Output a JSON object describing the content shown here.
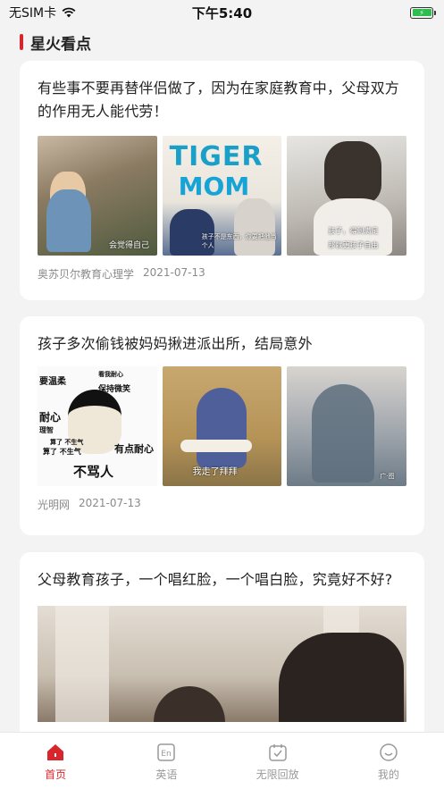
{
  "status_bar": {
    "carrier": "无SIM卡",
    "time": "下午5:40"
  },
  "section": {
    "title": "星火看点",
    "accent_color": "#d8262c"
  },
  "articles": [
    {
      "title": "有些事不要再替伴侣做了，因为在家庭教育中，父母双方的作用无人能代劳！",
      "images": [
        {
          "caption": "会觉得自己"
        },
        {
          "headline_1": "TIGER",
          "headline_2": "MOM",
          "caption": "孩子不是东西，你要把他当个人"
        },
        {
          "caption_1": "孩子，得到满足",
          "caption_2": "那就更孩子自由"
        }
      ],
      "source": "奥苏贝尔教育心理学",
      "date": "2021-07-13"
    },
    {
      "title": "孩子多次偷钱被妈妈揪进派出所，结局意外",
      "images": [
        {
          "words": [
            "看我耐心",
            "要温柔",
            "保持微笑",
            "耐心",
            "理智",
            "有点耐心",
            "算了 不生气",
            "算了 不生气"
          ],
          "big": "不骂人"
        },
        {
          "caption": "我走了拜拜"
        },
        {
          "caption": "广·图"
        }
      ],
      "source": "光明网",
      "date": "2021-07-13"
    },
    {
      "title": "父母教育孩子，一个唱红脸，一个唱白脸，究竟好不好?",
      "source": "",
      "date": ""
    }
  ],
  "tabs": [
    {
      "label": "首页",
      "icon": "home-icon",
      "active": true
    },
    {
      "label": "英语",
      "icon": "english-icon",
      "active": false
    },
    {
      "label": "无限回放",
      "icon": "playback-icon",
      "active": false
    },
    {
      "label": "我的",
      "icon": "profile-icon",
      "active": false
    }
  ],
  "colors": {
    "active_tab": "#d8262c",
    "inactive_tab": "#999999",
    "battery": "#2dbe4e"
  }
}
